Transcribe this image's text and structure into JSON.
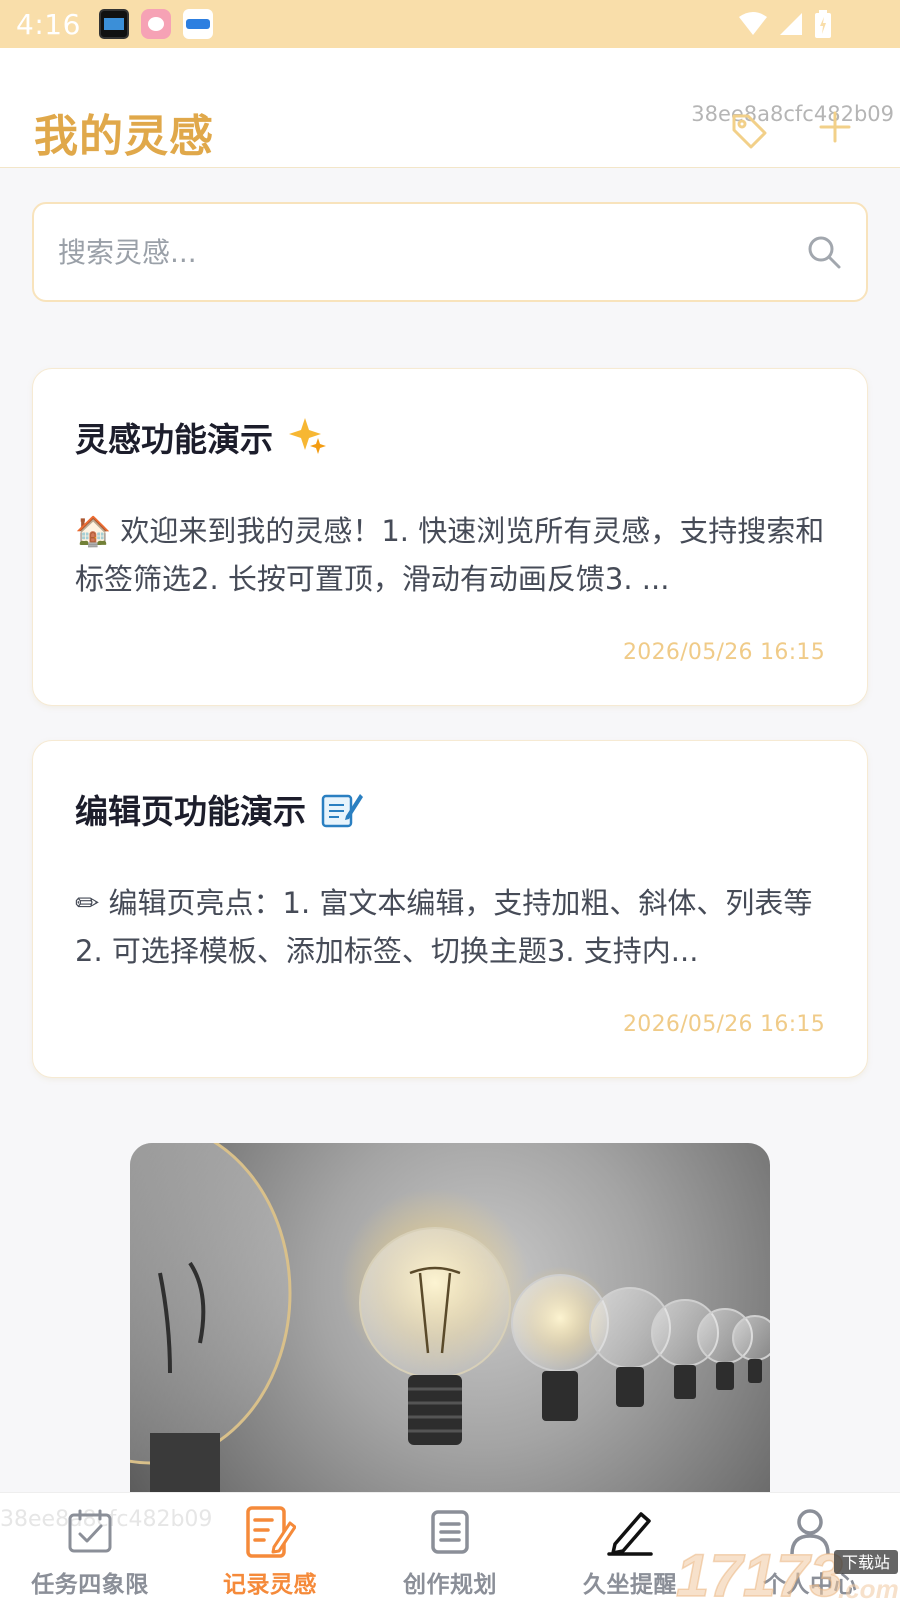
{
  "status_bar": {
    "time": "4:16"
  },
  "header": {
    "title": "我的灵感",
    "device_id": "38ee8a8cfc482b09",
    "tag_icon": "tag-icon",
    "add_icon": "plus-icon"
  },
  "search": {
    "placeholder": "搜索灵感...",
    "icon": "search-icon"
  },
  "notes": [
    {
      "title": "灵感功能演示",
      "title_emoji": "sparkles-icon",
      "body": "🏠 欢迎来到我的灵感！1. 快速浏览所有灵感，支持搜索和标签筛选2. 长按可置顶，滑动有动画反馈3. ...",
      "date": "2026/05/26 16:15"
    },
    {
      "title": "编辑页功能演示",
      "title_emoji": "memo-icon",
      "body": "✏ 编辑页亮点：1. 富文本编辑，支持加粗、斜体、列表等2. 可选择模板、添加标签、切换主题3. 支持内...",
      "date": "2026/05/26 16:15"
    }
  ],
  "image": {
    "subject": "lightbulbs-image"
  },
  "bottom_nav": {
    "faint_id": "38ee8a8cfc482b09",
    "items": [
      {
        "label": "任务四象限",
        "icon": "calendar-check-icon",
        "active": false
      },
      {
        "label": "记录灵感",
        "icon": "note-pen-icon",
        "active": true
      },
      {
        "label": "创作规划",
        "icon": "document-list-icon",
        "active": false
      },
      {
        "label": "久坐提醒",
        "icon": "pen-icon",
        "active": false
      },
      {
        "label": "个人中心",
        "icon": "person-icon",
        "active": false
      }
    ]
  },
  "watermark": {
    "text": "17173.com",
    "badge": "下载站"
  },
  "colors": {
    "status_bar": "#f9deaa",
    "title": "#e0a84a",
    "accent_active": "#f58a3a",
    "date": "#f0cb88",
    "search_border": "#f8e3bc"
  }
}
